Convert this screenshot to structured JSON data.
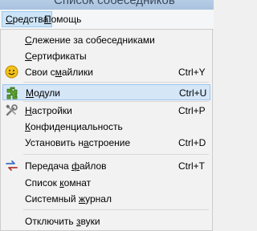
{
  "window": {
    "title": "Список собеседников"
  },
  "menubar": {
    "items": [
      {
        "mnemonic": "С",
        "rest": "редства"
      },
      {
        "mnemonic": "П",
        "rest": "омощь"
      }
    ]
  },
  "menu": {
    "items": [
      {
        "pre": "",
        "mnemonic": "С",
        "post": "лежение за собеседниками",
        "shortcut": "",
        "icon": ""
      },
      {
        "pre": "",
        "mnemonic": "С",
        "post": "ертификаты",
        "shortcut": "",
        "icon": ""
      },
      {
        "pre": "Свои с",
        "mnemonic": "м",
        "post": "айлики",
        "shortcut": "Ctrl+Y",
        "icon": "smiley-icon"
      },
      {
        "pre": "",
        "mnemonic": "М",
        "post": "одули",
        "shortcut": "Ctrl+U",
        "icon": "puzzle-piece-icon"
      },
      {
        "pre": "",
        "mnemonic": "Н",
        "post": "астройки",
        "shortcut": "Ctrl+P",
        "icon": "wrench-screwdriver-icon"
      },
      {
        "pre": "",
        "mnemonic": "К",
        "post": "онфиденциальность",
        "shortcut": "",
        "icon": ""
      },
      {
        "pre": "Установить н",
        "mnemonic": "а",
        "post": "строение",
        "shortcut": "Ctrl+D",
        "icon": ""
      },
      {
        "pre": "Передача ",
        "mnemonic": "ф",
        "post": "айлов",
        "shortcut": "Ctrl+T",
        "icon": "file-transfer-icon"
      },
      {
        "pre": "Список ",
        "mnemonic": "к",
        "post": "омнат",
        "shortcut": "",
        "icon": ""
      },
      {
        "pre": "Системный ",
        "mnemonic": "ж",
        "post": "урнал",
        "shortcut": "",
        "icon": ""
      },
      {
        "pre": "Отключить ",
        "mnemonic": "з",
        "post": "вуки",
        "shortcut": "",
        "icon": ""
      }
    ]
  }
}
